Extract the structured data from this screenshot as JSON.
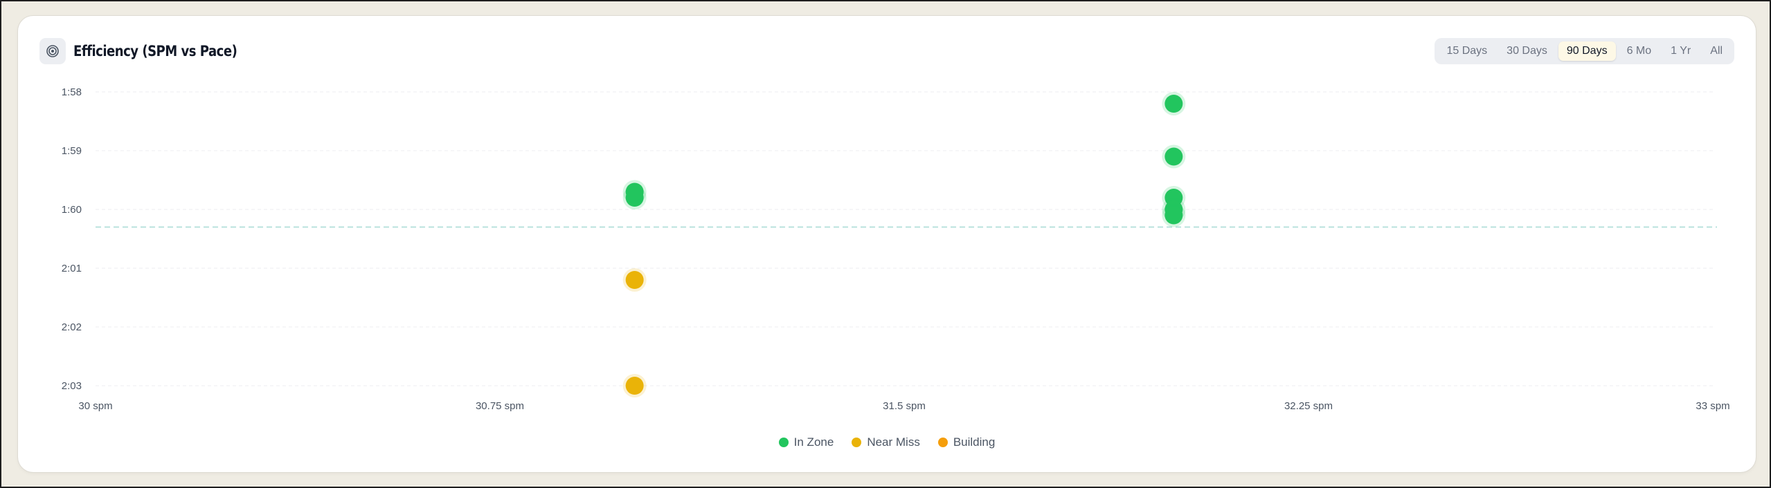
{
  "card": {
    "title": "Efficiency (SPM vs Pace)",
    "icon": "target-icon"
  },
  "range_tabs": [
    {
      "label": "15 Days",
      "active": false
    },
    {
      "label": "30 Days",
      "active": false
    },
    {
      "label": "90 Days",
      "active": true
    },
    {
      "label": "6 Mo",
      "active": false
    },
    {
      "label": "1 Yr",
      "active": false
    },
    {
      "label": "All",
      "active": false
    }
  ],
  "legend": [
    {
      "label": "In Zone",
      "color": "#22c55e"
    },
    {
      "label": "Near Miss",
      "color": "#eab308"
    },
    {
      "label": "Building",
      "color": "#f59e0b"
    }
  ],
  "chart_data": {
    "type": "scatter",
    "title": "Efficiency (SPM vs Pace)",
    "xlabel": "",
    "ylabel": "",
    "x_ticks": [
      "30 spm",
      "30.75 spm",
      "31.5 spm",
      "32.25 spm",
      "33 spm"
    ],
    "y_ticks": [
      "1:58",
      "1:59",
      "1:60",
      "2:01",
      "2:02",
      "2:03"
    ],
    "xlim": [
      30,
      33
    ],
    "ylim_seconds": [
      118,
      123
    ],
    "y_reversed": true,
    "target_line_pace_seconds": 120.3,
    "grid": true,
    "legend_position": "bottom",
    "series": [
      {
        "name": "In Zone",
        "color": "#22c55e",
        "points": [
          {
            "x": 31.0,
            "y": "1:59.8"
          },
          {
            "x": 31.0,
            "y": "1:59.7"
          },
          {
            "x": 32.0,
            "y": "1:58.2"
          },
          {
            "x": 32.0,
            "y": "1:59.1"
          },
          {
            "x": 32.0,
            "y": "1:59.8"
          },
          {
            "x": 32.0,
            "y": "1:60.0"
          },
          {
            "x": 32.0,
            "y": "1:60.1"
          }
        ]
      },
      {
        "name": "Near Miss",
        "color": "#eab308",
        "points": [
          {
            "x": 31.0,
            "y": "2:01.2"
          },
          {
            "x": 31.0,
            "y": "2:03.0"
          }
        ]
      },
      {
        "name": "Building",
        "color": "#f59e0b",
        "points": []
      }
    ]
  }
}
